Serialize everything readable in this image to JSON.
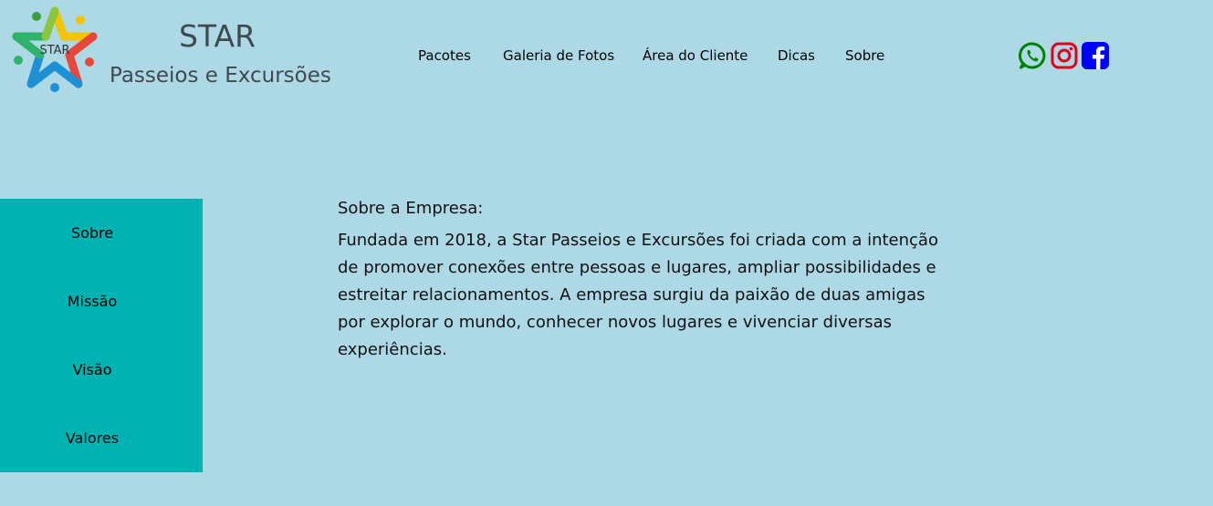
{
  "brand": {
    "logo_text": "STAR",
    "title": "STAR",
    "subtitle": "Passeios e Excursões"
  },
  "nav": {
    "items": [
      {
        "label": "Pacotes"
      },
      {
        "label": "Galeria de Fotos"
      },
      {
        "label": "Área do Cliente"
      },
      {
        "label": "Dicas"
      },
      {
        "label": "Sobre"
      }
    ]
  },
  "social": {
    "icons": [
      "whatsapp-icon",
      "instagram-icon",
      "facebook-icon"
    ],
    "colors": {
      "whatsapp": "#008000",
      "instagram": "#e0001b",
      "facebook": "#0000ff"
    }
  },
  "sidebar": {
    "items": [
      {
        "label": "Sobre"
      },
      {
        "label": "Missão"
      },
      {
        "label": "Visão"
      },
      {
        "label": "Valores"
      }
    ]
  },
  "content": {
    "heading": "Sobre a Empresa:",
    "body": "Fundada em 2018, a Star Passeios e Excursões foi criada com a intenção de promover conexões entre pessoas e lugares, ampliar possibilidades e estreitar relacionamentos. A empresa surgiu da paixão de duas amigas por explorar o mundo, conhecer novos lugares e vivenciar diversas experiências."
  },
  "colors": {
    "page_background": "#add8e6",
    "sidebar_background": "#00b3b3",
    "brand_text": "#3f4a4f"
  }
}
